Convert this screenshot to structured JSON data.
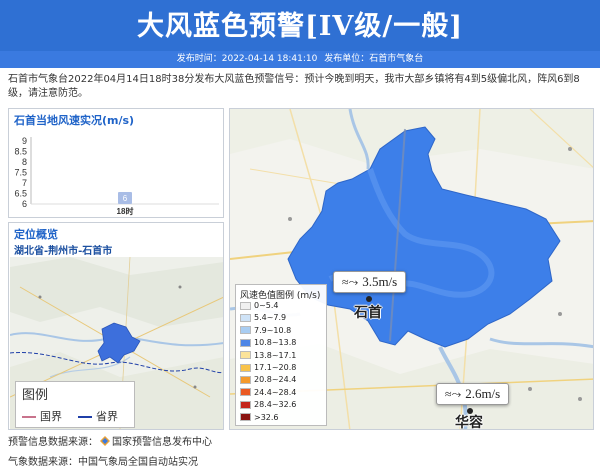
{
  "header": {
    "title": "大风蓝色预警[IV级/一般]",
    "publish_time_label": "发布时间：2022-04-14 18:41:10",
    "publisher_label": "发布单位：石首市气象台"
  },
  "summary": "石首市气象台2022年04月14日18时38分发布大风蓝色预警信号：预计今晚到明天，我市大部乡镇将有4到5级偏北风，阵风6到8级，请注意防范。",
  "wind_panel": {
    "title": "石首当地风速实况(m/s)"
  },
  "chart_data": {
    "type": "bar",
    "categories": [
      "18时"
    ],
    "values": [
      6
    ],
    "data_labels": [
      "6"
    ],
    "ylabel": "",
    "ylim": [
      6,
      9
    ],
    "yticks": [
      "9",
      "8.5",
      "8",
      "7.5",
      "7",
      "6.5",
      "6"
    ],
    "bar_color": "#a9bde6"
  },
  "location_panel": {
    "title": "定位概览",
    "path": "湖北省-荆州市-石首市",
    "legend": {
      "title": "图例",
      "items": [
        {
          "label": "国界",
          "color": "#c8738c"
        },
        {
          "label": "省界",
          "color": "#1f3fa8"
        }
      ]
    }
  },
  "main_map": {
    "wind_color_legend": {
      "title": "风速色值图例 (m/s)",
      "rows": [
        {
          "label": "0~5.4",
          "color": "#f0f0f0"
        },
        {
          "label": "5.4~7.9",
          "color": "#cfe3f7"
        },
        {
          "label": "7.9~10.8",
          "color": "#a9cdf2"
        },
        {
          "label": "10.8~13.8",
          "color": "#4f86e6"
        },
        {
          "label": "13.8~17.1",
          "color": "#fbe39a"
        },
        {
          "label": "17.1~20.8",
          "color": "#f8c34a"
        },
        {
          "label": "20.8~24.4",
          "color": "#f49a2c"
        },
        {
          "label": "24.4~28.4",
          "color": "#ea5a22"
        },
        {
          "label": "28.4~32.6",
          "color": "#c4261c"
        },
        {
          "label": ">32.6",
          "color": "#8a1410"
        }
      ]
    },
    "stations": [
      {
        "name": "石首",
        "wind": "3.5m/s"
      },
      {
        "name": "华容",
        "wind": "2.6m/s"
      }
    ],
    "warning_area_color": "#3d7fe9"
  },
  "sources": {
    "warning_source": "预警信息数据来源：",
    "warning_source_name": "国家预警信息发布中心",
    "weather_source": "气象数据来源：中国气象局全国自动站实况"
  }
}
